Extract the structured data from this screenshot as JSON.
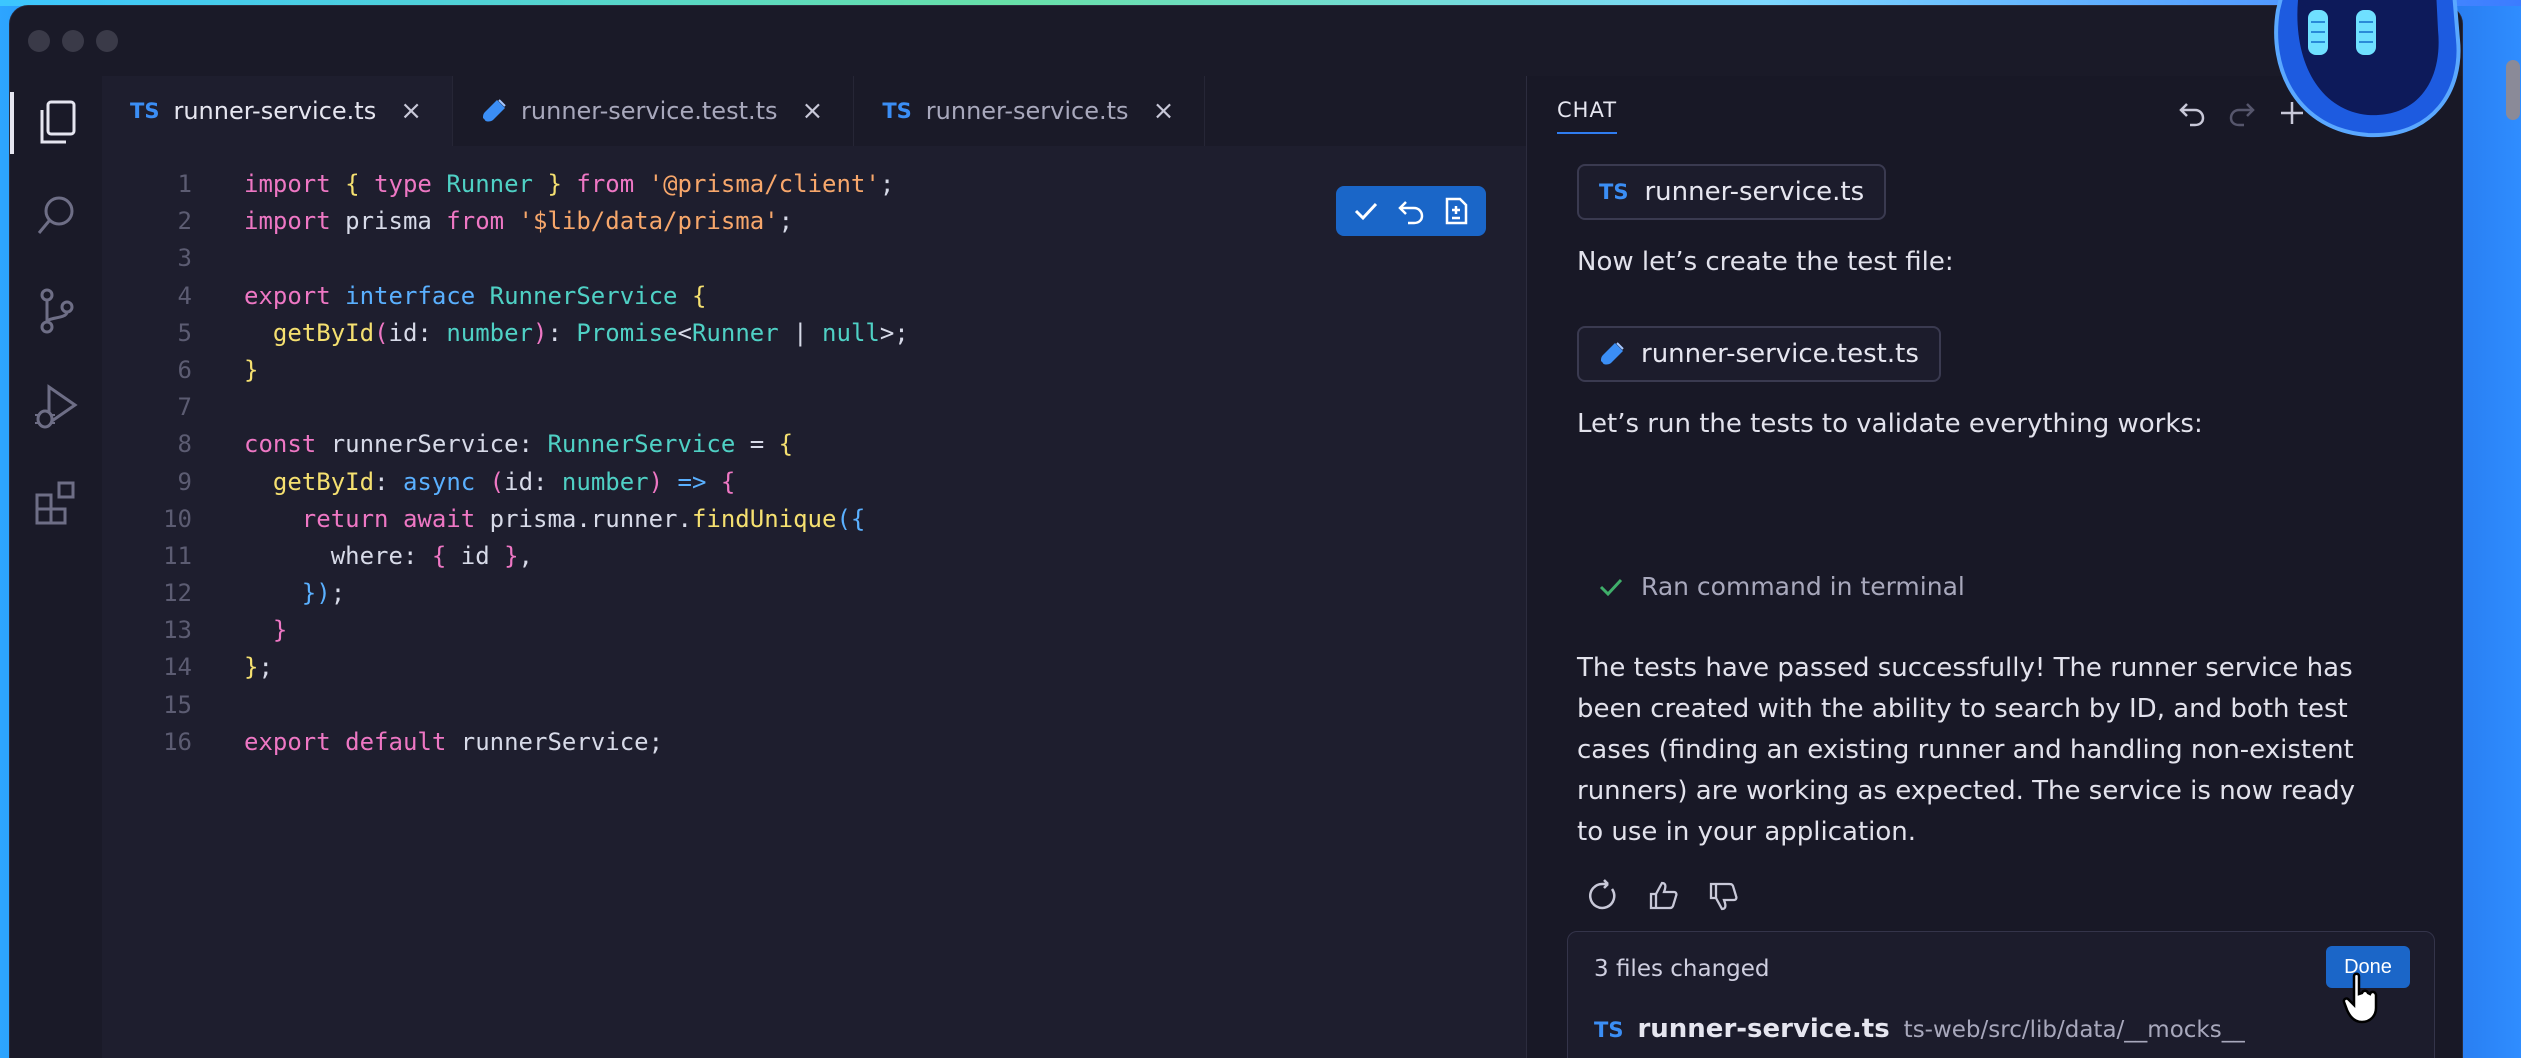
{
  "editor": {
    "tabs": [
      {
        "badge": "TS",
        "label": "runner-service.ts",
        "icon": "ts-badge",
        "active": true,
        "close": "×"
      },
      {
        "badge": "",
        "label": "runner-service.test.ts",
        "icon": "test-flask-icon",
        "active": false,
        "close": "×"
      },
      {
        "badge": "TS",
        "label": "runner-service.ts",
        "icon": "ts-badge",
        "active": false,
        "close": "×"
      }
    ],
    "line_numbers": [
      "1",
      "2",
      "3",
      "4",
      "5",
      "6",
      "7",
      "8",
      "9",
      "10",
      "11",
      "12",
      "13",
      "14",
      "15",
      "16"
    ],
    "code_lines": [
      "import { type Runner } from '@prisma/client';",
      "import prisma from '$lib/data/prisma';",
      "",
      "export interface RunnerService {",
      "  getById(id: number): Promise<Runner | null>;",
      "}",
      "",
      "const runnerService: RunnerService = {",
      "  getById: async (id: number) => {",
      "    return await prisma.runner.findUnique({",
      "      where: { id },",
      "    });",
      "  }",
      "};",
      "",
      "export default runnerService;"
    ],
    "inline_actions": [
      "accept-check-icon",
      "undo-icon",
      "diff-file-icon"
    ]
  },
  "chat": {
    "title": "CHAT",
    "header_icons": [
      "undo-icon",
      "redo-icon",
      "plus-icon"
    ],
    "chip1": {
      "badge": "TS",
      "label": "runner-service.ts"
    },
    "text1": "Now let’s create the test file:",
    "chip2": {
      "label": "runner-service.test.ts"
    },
    "text2": "Let’s run the tests to validate everything works:",
    "ran_command": "Ran command in terminal",
    "summary_lines": [
      "The tests have passed successfully! The runner service has",
      "been created with the ability to search by ID, and both test",
      "cases (finding an existing runner and handling non-existent",
      "runners) are working as expected. The service is now ready",
      "to use in your application."
    ],
    "feedback_icons": [
      "retry-icon",
      "thumbs-up-icon",
      "thumbs-down-icon"
    ],
    "changes": {
      "title": "3 files changed",
      "done_label": "Done",
      "file": {
        "badge": "TS",
        "name": "runner-service.ts",
        "path": "ts-web/src/lib/data/__mocks__"
      }
    }
  },
  "colors": {
    "accent": "#1b66c8",
    "ts_blue": "#3b8ef5",
    "success_green": "#3fae6a",
    "editor_bg": "#1e1e2e",
    "chat_bg": "#181826"
  }
}
